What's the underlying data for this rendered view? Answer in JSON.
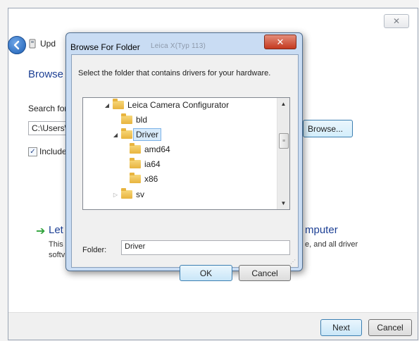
{
  "wizard": {
    "close_glyph": "✕",
    "title": "Upd",
    "heading": "Browse",
    "search_label": "Search for",
    "path_value": "C:\\Users\\",
    "include_label": "Include",
    "include_checked": true,
    "browse_button": "Browse...",
    "let_title": "Let",
    "let_desc_line1": "This",
    "let_desc_line2": "softv",
    "computer_title": "mputer",
    "computer_desc": "e, and all driver",
    "next_button": "Next",
    "cancel_button": "Cancel"
  },
  "dialog": {
    "title": "Browse For Folder",
    "faded_title": "Leica X(Typ 113)",
    "close_glyph": "✕",
    "instruction": "Select the folder that contains drivers for your hardware.",
    "tree": [
      {
        "label": "Leica Camera Configurator",
        "expander": "◢"
      },
      {
        "label": "bld",
        "expander": ""
      },
      {
        "label": "Driver",
        "expander": "◢",
        "selected": true
      },
      {
        "label": "amd64",
        "expander": ""
      },
      {
        "label": "ia64",
        "expander": ""
      },
      {
        "label": "x86",
        "expander": ""
      },
      {
        "label": "sv",
        "expander": "▷"
      }
    ],
    "folder_label": "Folder:",
    "folder_value": "Driver",
    "ok_button": "OK",
    "cancel_button": "Cancel"
  },
  "icons": {
    "back": "back-arrow-icon",
    "device": "device-icon",
    "folder": "folder-icon",
    "green_arrow": "green-arrow-icon"
  },
  "colors": {
    "heading": "#1c3f94",
    "dialog_frame": "#c9dcf3",
    "close_red": "#c4391f",
    "selection": "#d8ebfb"
  }
}
